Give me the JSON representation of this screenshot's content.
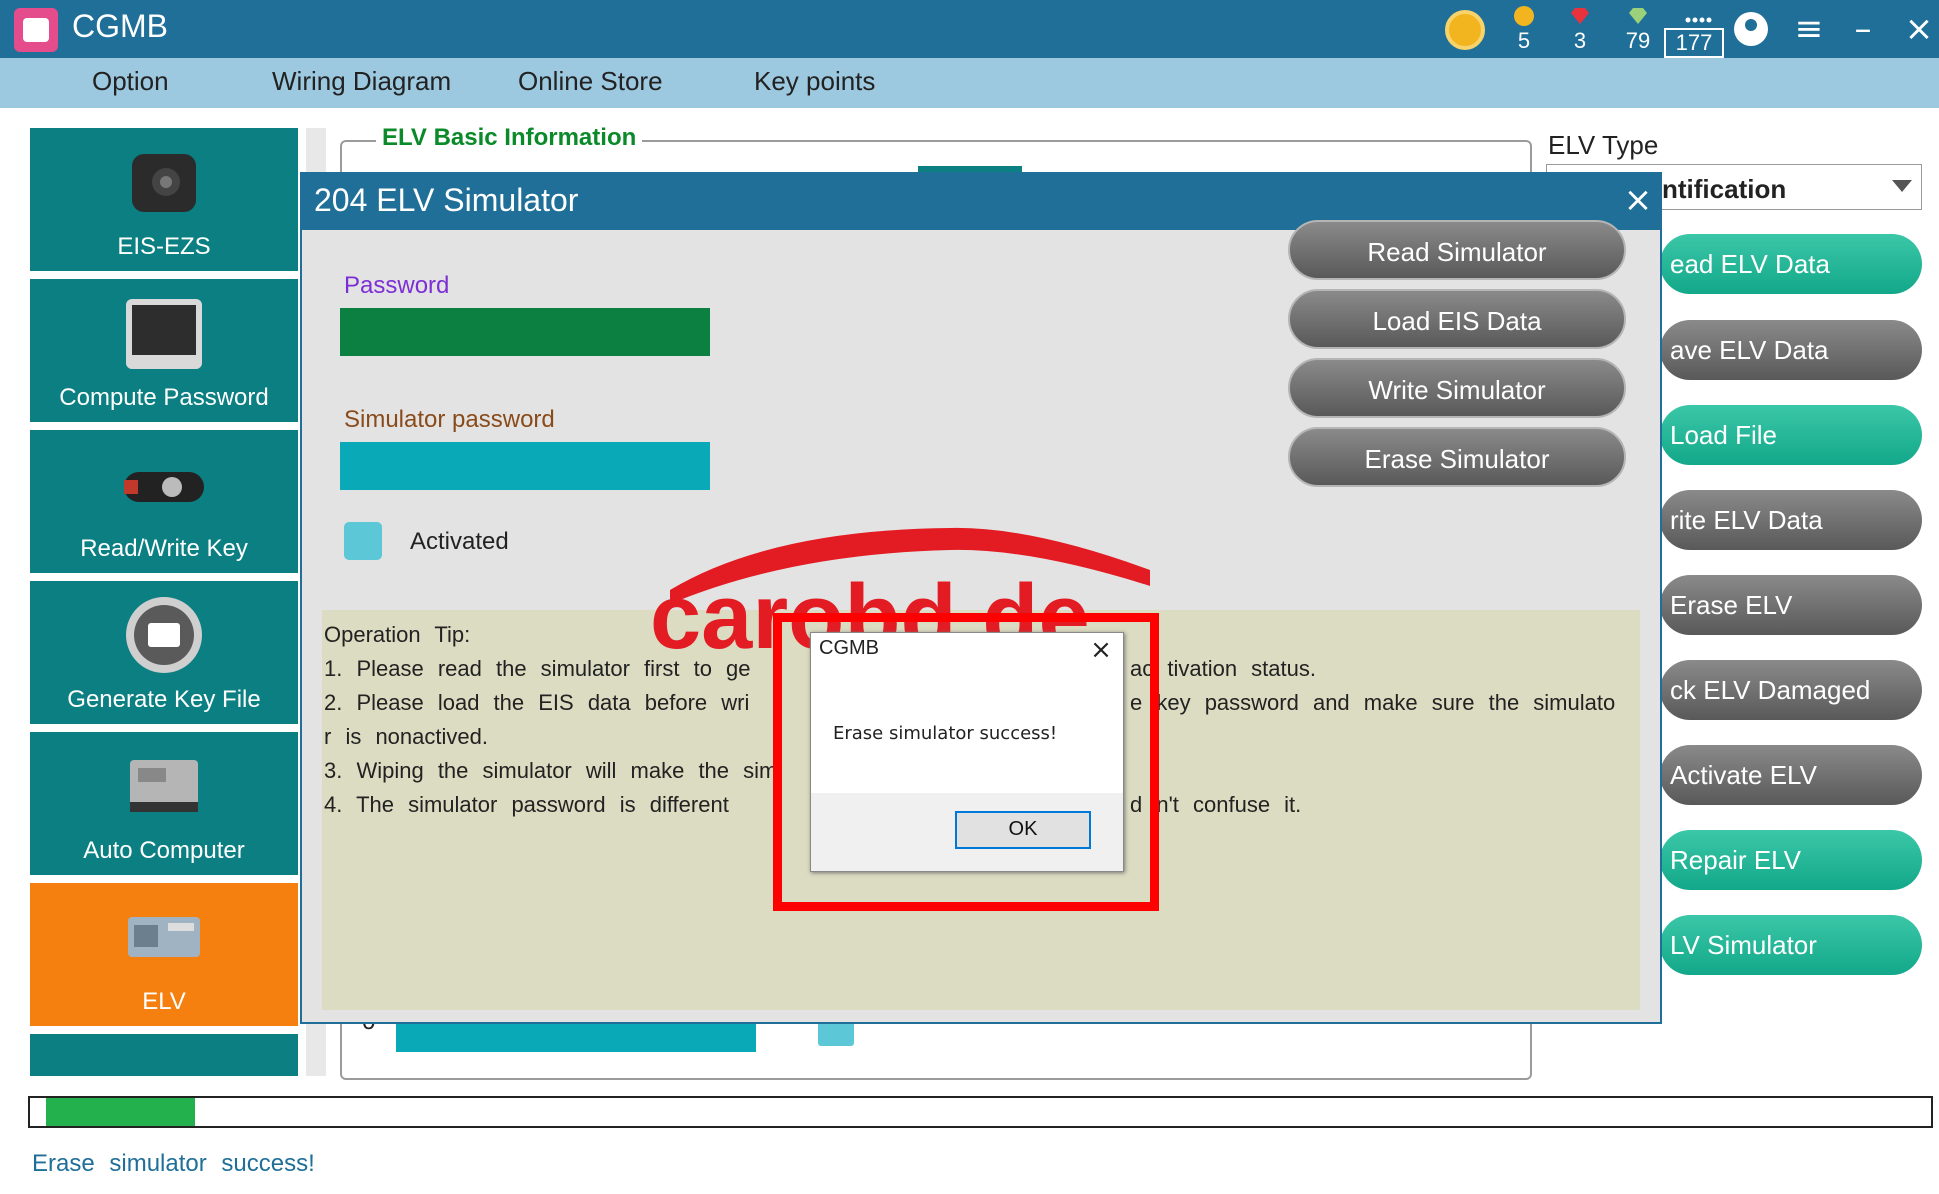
{
  "app": {
    "title": "CGMB"
  },
  "stats": [
    {
      "name": "coin",
      "value": "5",
      "color": "#f3b51f"
    },
    {
      "name": "ruby",
      "value": "3",
      "color": "#e8323c"
    },
    {
      "name": "gem",
      "value": "79",
      "color": "#9ad17a"
    },
    {
      "name": "points",
      "value": "177",
      "color": "#ffffff"
    }
  ],
  "menu": [
    "Option",
    "Wiring Diagram",
    "Online Store",
    "Key points"
  ],
  "sidebar": {
    "items": [
      {
        "label": "EIS-EZS",
        "icon": "eis-ezs-icon"
      },
      {
        "label": "Compute Password",
        "icon": "compute-password-icon"
      },
      {
        "label": "Read/Write Key",
        "icon": "car-key-icon"
      },
      {
        "label": "Generate Key File",
        "icon": "printer-icon"
      },
      {
        "label": "Auto Computer",
        "icon": "ecu-icon"
      },
      {
        "label": "ELV",
        "icon": "elv-module-icon",
        "active": true
      }
    ]
  },
  "elv_group": {
    "title": "ELV Basic Information",
    "field_prefix": "o"
  },
  "right_panel": {
    "type_label": "ELV Type",
    "type_value": "ntification",
    "buttons": [
      {
        "label": "ead ELV Data",
        "style": "teal"
      },
      {
        "label": "ave ELV Data",
        "style": "gray"
      },
      {
        "label": "Load File",
        "style": "teal"
      },
      {
        "label": "rite ELV Data",
        "style": "gray"
      },
      {
        "label": "Erase ELV",
        "style": "gray"
      },
      {
        "label": "ck ELV Damaged",
        "style": "gray"
      },
      {
        "label": "Activate ELV",
        "style": "gray"
      },
      {
        "label": "Repair ELV",
        "style": "teal"
      },
      {
        "label": "LV Simulator",
        "style": "teal"
      }
    ]
  },
  "modal": {
    "title": "204 ELV Simulator",
    "password_label": "Password",
    "sim_password_label": "Simulator password",
    "activated_label": "Activated",
    "buttons": [
      "Read Simulator",
      "Load EIS Data",
      "Write Simulator",
      "Erase Simulator"
    ],
    "tips": [
      "Operation  Tip:",
      "1.  Please  read  the  simulator  first  to  ge",
      "2.  Please  load  the  EIS  data  before  wri",
      "r  is  nonactived.",
      "3.  Wiping  the  simulator  will  make  the  sim",
      "4.  The  simulator  password  is  different"
    ],
    "tips_right": [
      "ac tivation  status.",
      "e  key  password  and  make  sure  the  simulato",
      "d n't  confuse  it."
    ]
  },
  "watermark": {
    "text": "carobd.de",
    "color_red": "#e31c23"
  },
  "msgbox": {
    "title": "CGMB",
    "message": "Erase simulator success!",
    "ok": "OK"
  },
  "progress": {
    "fraction": 0.08,
    "color": "#22b14c"
  },
  "status": {
    "text": "Erase  simulator  success!"
  }
}
